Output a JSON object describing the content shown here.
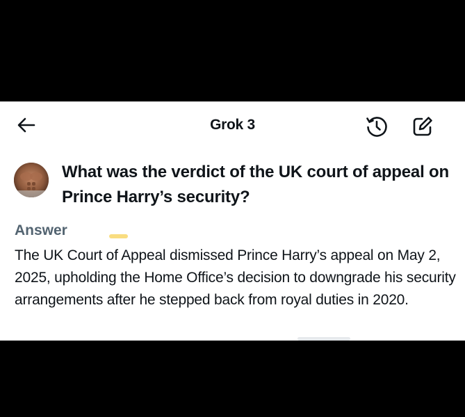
{
  "header": {
    "title": "Grok 3",
    "back_icon": "arrow-left-icon",
    "history_icon": "history-icon",
    "edit_icon": "compose-icon"
  },
  "question": {
    "avatar": "user-avatar",
    "text": "What was the verdict of the UK court of appeal on Prince Harry’s security?"
  },
  "answer": {
    "label": "Answer",
    "text": "The UK Court of Appeal dismissed Prince Harry’s appeal on May 2, 2025, upholding the Home Office’s decision to downgrade his security arrangements after he stepped back from royal duties in 2020."
  },
  "colors": {
    "text_primary": "#0f1419",
    "text_secondary": "#536471",
    "background": "#ffffff",
    "highlight": "#f8d76a"
  }
}
